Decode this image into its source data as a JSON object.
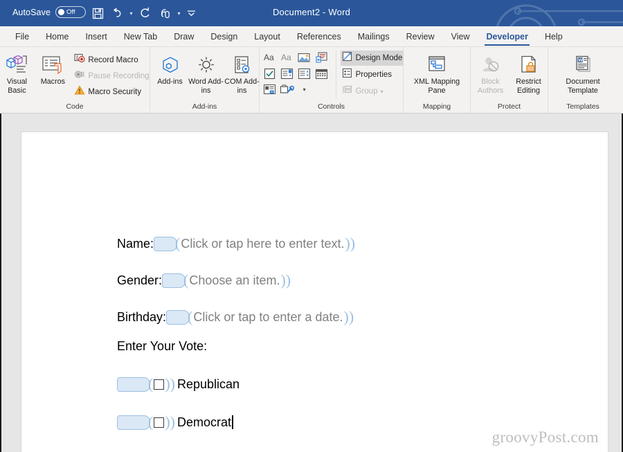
{
  "titlebar": {
    "autosave_label": "AutoSave",
    "autosave_state": "Off",
    "document_title": "Document2  -  Word",
    "quick_access": [
      {
        "name": "save-icon",
        "tooltip": "Save"
      },
      {
        "name": "undo-icon",
        "tooltip": "Undo"
      },
      {
        "name": "redo-icon",
        "tooltip": "Redo"
      },
      {
        "name": "touch-mouse-mode-icon",
        "tooltip": "Touch/Mouse Mode"
      },
      {
        "name": "customize-quick-access-toolbar-icon",
        "tooltip": "Customize Quick Access Toolbar"
      }
    ],
    "bg_color": "#2b579a"
  },
  "tabs": [
    {
      "label": "File",
      "active": false
    },
    {
      "label": "Home",
      "active": false
    },
    {
      "label": "Insert",
      "active": false
    },
    {
      "label": "New Tab",
      "active": false
    },
    {
      "label": "Draw",
      "active": false
    },
    {
      "label": "Design",
      "active": false
    },
    {
      "label": "Layout",
      "active": false
    },
    {
      "label": "References",
      "active": false
    },
    {
      "label": "Mailings",
      "active": false
    },
    {
      "label": "Review",
      "active": false
    },
    {
      "label": "View",
      "active": false
    },
    {
      "label": "Developer",
      "active": true
    },
    {
      "label": "Help",
      "active": false
    }
  ],
  "ribbon": {
    "accent_color": "#2b579a",
    "groups": [
      {
        "label": "Code",
        "big_buttons": [
          {
            "label": "Visual Basic",
            "icon": "visual-basic-icon",
            "disabled": false
          },
          {
            "label": "Macros",
            "icon": "macros-icon",
            "disabled": false
          }
        ],
        "small_buttons": [
          {
            "label": "Record Macro",
            "icon": "record-macro-icon",
            "disabled": false
          },
          {
            "label": "Pause Recording",
            "icon": "pause-recording-icon",
            "disabled": true
          },
          {
            "label": "Macro Security",
            "icon": "macro-security-icon",
            "disabled": false
          }
        ]
      },
      {
        "label": "Add-ins",
        "big_buttons": [
          {
            "label": "Add-ins",
            "icon": "add-ins-icon",
            "disabled": false
          },
          {
            "label": "Word Add-ins",
            "icon": "word-add-ins-icon",
            "disabled": false
          },
          {
            "label": "COM Add-ins",
            "icon": "com-add-ins-icon",
            "disabled": false
          }
        ],
        "small_buttons": []
      },
      {
        "label": "Controls",
        "control_icons": [
          "rich-text-content-control-icon",
          "plain-text-content-control-icon",
          "picture-content-control-icon",
          "building-block-gallery-content-control-icon",
          "check-box-content-control-icon",
          "combo-box-content-control-icon",
          "drop-down-list-content-control-icon",
          "date-picker-content-control-icon",
          "repeating-section-content-control-icon",
          "legacy-tools-icon"
        ],
        "small_buttons": [
          {
            "label": "Design Mode",
            "icon": "design-mode-icon",
            "disabled": false,
            "highlight": true
          },
          {
            "label": "Properties",
            "icon": "properties-icon",
            "disabled": false,
            "highlight": false
          },
          {
            "label": "Group",
            "icon": "group-icon",
            "disabled": true,
            "highlight": false
          }
        ]
      },
      {
        "label": "Mapping",
        "big_buttons": [
          {
            "label": "XML Mapping Pane",
            "icon": "xml-mapping-pane-icon",
            "disabled": false
          }
        ],
        "small_buttons": []
      },
      {
        "label": "Protect",
        "big_buttons": [
          {
            "label": "Block Authors",
            "icon": "block-authors-icon",
            "disabled": true
          },
          {
            "label": "Restrict Editing",
            "icon": "restrict-editing-icon",
            "disabled": false
          }
        ],
        "small_buttons": []
      },
      {
        "label": "Templates",
        "big_buttons": [
          {
            "label": "Document Template",
            "icon": "document-template-icon",
            "disabled": false
          }
        ],
        "small_buttons": []
      }
    ]
  },
  "document": {
    "fields": [
      {
        "label": "Name:",
        "placeholder": "Click or tap here to enter text.",
        "kind": "text"
      },
      {
        "label": "Gender:",
        "placeholder": "Choose an item.",
        "kind": "text"
      },
      {
        "label": "Birthday:",
        "placeholder": "Click or tap to enter a date.",
        "kind": "text"
      }
    ],
    "vote_heading": "Enter Your Vote:",
    "checkbox_options": [
      {
        "label": "Republican",
        "checked": false,
        "has_caret": false
      },
      {
        "label": "Democrat",
        "checked": false,
        "has_caret": true
      }
    ],
    "watermark": "groovyPost.com",
    "content_control_fill": "#dbe8f5",
    "content_control_border": "#9cc0e4",
    "placeholder_color": "#808080"
  }
}
